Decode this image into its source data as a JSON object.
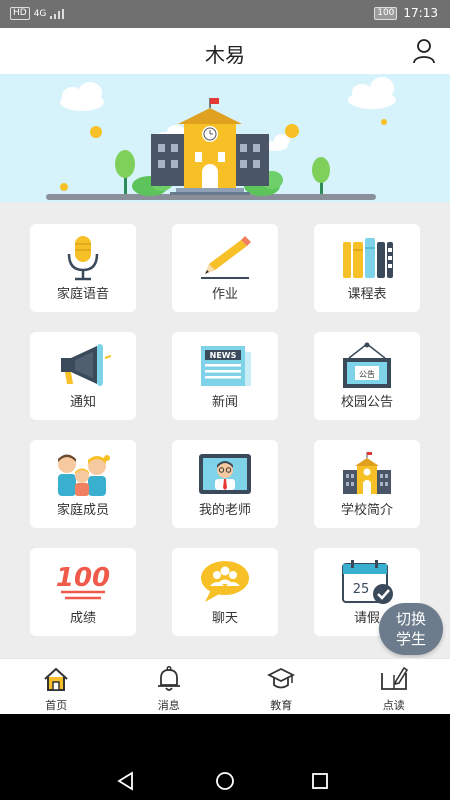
{
  "status_bar": {
    "network": "HD",
    "signal_type": "4G",
    "battery": "100",
    "time": "17:13"
  },
  "header": {
    "title": "木易"
  },
  "grid": [
    {
      "label": "家庭语音",
      "icon": "microphone-icon"
    },
    {
      "label": "作业",
      "icon": "pencil-icon"
    },
    {
      "label": "课程表",
      "icon": "books-icon"
    },
    {
      "label": "通知",
      "icon": "megaphone-icon"
    },
    {
      "label": "新闻",
      "icon": "newspaper-icon"
    },
    {
      "label": "校园公告",
      "icon": "notice-board-icon"
    },
    {
      "label": "家庭成员",
      "icon": "family-icon"
    },
    {
      "label": "我的老师",
      "icon": "teacher-icon"
    },
    {
      "label": "学校简介",
      "icon": "school-icon"
    },
    {
      "label": "成绩",
      "icon": "score-icon"
    },
    {
      "label": "聊天",
      "icon": "chat-icon"
    },
    {
      "label": "请假",
      "icon": "calendar-icon"
    }
  ],
  "icon_text": {
    "news": "NEWS",
    "notice": "公告",
    "score": "100",
    "calendar_day": "25"
  },
  "switch_button": {
    "line1": "切换",
    "line2": "学生"
  },
  "tabs": [
    {
      "label": "首页",
      "icon": "home-icon",
      "active": true
    },
    {
      "label": "消息",
      "icon": "bell-icon",
      "active": false
    },
    {
      "label": "教育",
      "icon": "graduation-cap-icon",
      "active": false
    },
    {
      "label": "点读",
      "icon": "read-icon",
      "active": false
    }
  ],
  "colors": {
    "accent_yellow": "#f6c026",
    "banner_bg": "#d6f2fb",
    "switch_bg": "#6d7c8c",
    "score_red": "#f05a4a"
  }
}
